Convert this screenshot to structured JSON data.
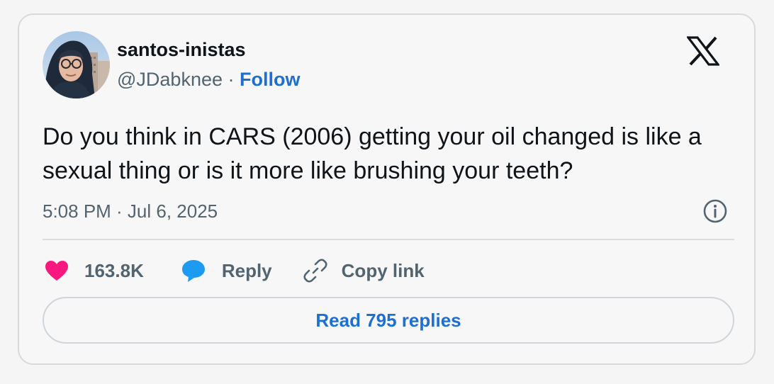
{
  "author": {
    "display_name": "santos-inistas",
    "handle": "@JDabknee",
    "separator": " · ",
    "follow_label": "Follow"
  },
  "tweet": {
    "text": "Do you think in CARS (2006) getting your oil changed is like a sexual thing or is it more like brushing your teeth?",
    "timestamp": "5:08 PM · Jul 6, 2025"
  },
  "actions": {
    "like_count": "163.8K",
    "reply_label": "Reply",
    "copy_link_label": "Copy link"
  },
  "read_replies_label": "Read 795 replies",
  "icons": {
    "brand": "x-logo-icon",
    "info": "info-icon",
    "like": "heart-icon",
    "reply": "speech-bubble-icon",
    "copy": "link-icon"
  },
  "colors": {
    "link_blue": "#1d6fd1",
    "heart_pink": "#f91880",
    "reply_blue": "#1d9bf0",
    "text_primary": "#0f1419",
    "text_secondary": "#536471"
  }
}
